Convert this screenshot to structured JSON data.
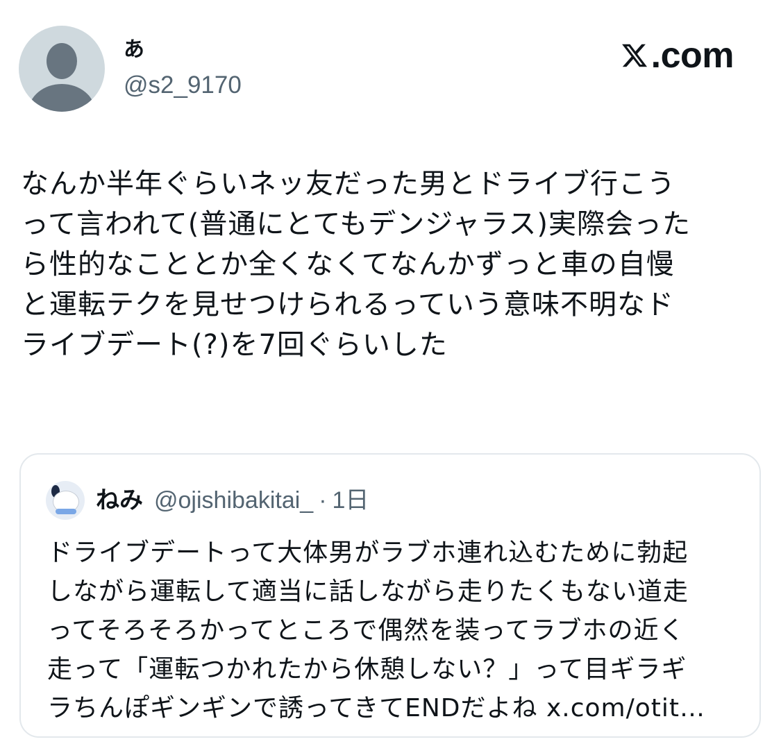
{
  "author": {
    "display_name": "あ",
    "handle": "@s2_9170",
    "avatar_icon": "default-profile-icon"
  },
  "brand": {
    "logo_icon": "x-logo-icon",
    "text": ".com"
  },
  "tweet": {
    "text": "なんか半年ぐらいネッ友だった男とドライブ行こう\nって言われて(普通にとてもデンジャラス)実際会った\nら性的なこととか全くなくてなんかずっと車の自慢\nと運転テクを見せつけられるっていう意味不明なド\nライブデート(?)を7回ぐらいした"
  },
  "quoted_tweet": {
    "display_name": "ねみ",
    "handle": "@ojishibakitai_",
    "separator": "·",
    "time": "1日",
    "text": "ドライブデートって大体男がラブホ連れ込むために勃起\nしながら運転して適当に話しながら走りたくもない道走\nってそろそろかってところで偶然を装ってラブホの近く\n走って「運転つかれたから休憩しない？」って目ギラギ\nラちんぽギンギンで誘ってきてENDだよね x.com/otit…"
  },
  "colors": {
    "text_primary": "#0f1419",
    "text_secondary": "#536471",
    "border": "#e3e8ec",
    "avatar_bg": "#cfd9de"
  }
}
